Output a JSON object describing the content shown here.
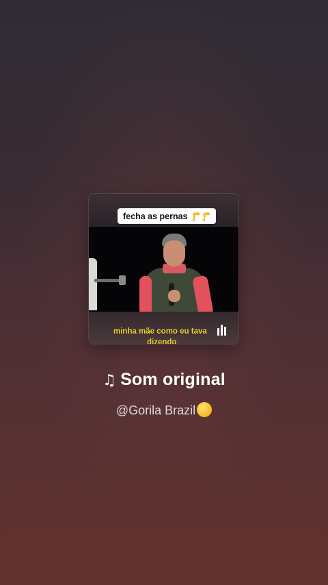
{
  "audio_card": {
    "caption_top": "fecha as pernas",
    "caption_emoji": "🦵🦵",
    "subtitle_line1": "minha mãe como eu tava",
    "subtitle_line2": "dizendo",
    "playing_indicator": "audio-bars-icon"
  },
  "sound": {
    "note_icon": "♫",
    "title": "Som original",
    "author": "@Gorila Brazil",
    "author_emoji": "🤣"
  },
  "colors": {
    "subtitle": "#f3d23a",
    "title": "#ffffff",
    "author": "#e4d8d8"
  }
}
